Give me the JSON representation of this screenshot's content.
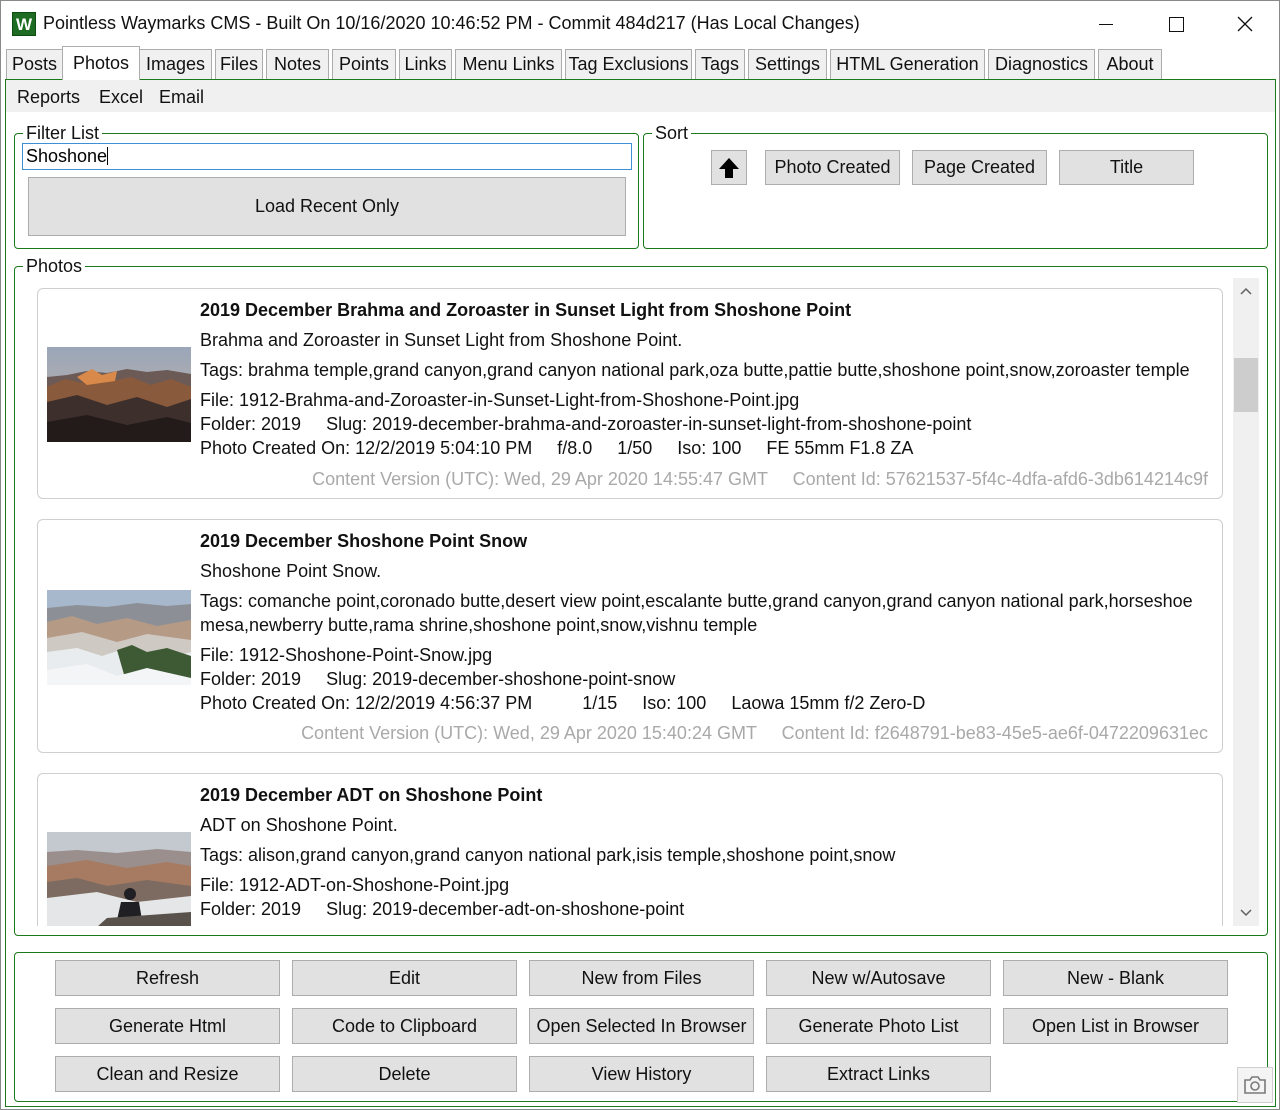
{
  "window": {
    "title": "Pointless Waymarks CMS - Built On 10/16/2020 10:46:52 PM - Commit 484d217 (Has Local Changes)",
    "icon_letter": "W"
  },
  "tabs": [
    {
      "label": "Posts"
    },
    {
      "label": "Photos",
      "active": true
    },
    {
      "label": "Images"
    },
    {
      "label": "Files"
    },
    {
      "label": "Notes"
    },
    {
      "label": "Points"
    },
    {
      "label": "Links"
    },
    {
      "label": "Menu Links"
    },
    {
      "label": "Tag Exclusions"
    },
    {
      "label": "Tags"
    },
    {
      "label": "Settings"
    },
    {
      "label": "HTML Generation"
    },
    {
      "label": "Diagnostics"
    },
    {
      "label": "About"
    }
  ],
  "menu": {
    "reports": "Reports",
    "excel": "Excel",
    "email": "Email"
  },
  "filter": {
    "group_label": "Filter List",
    "value": "Shoshone",
    "load_recent_label": "Load Recent Only"
  },
  "sort": {
    "group_label": "Sort",
    "photo_created_label": "Photo Created",
    "page_created_label": "Page Created",
    "title_label": "Title"
  },
  "photos": {
    "group_label": "Photos",
    "items": [
      {
        "title": "2019 December Brahma and Zoroaster in Sunset Light from Shoshone Point",
        "summary": "Brahma and Zoroaster in Sunset Light from Shoshone Point.",
        "tags": "Tags: brahma temple,grand canyon,grand canyon national park,oza butte,pattie butte,shoshone point,snow,zoroaster temple",
        "file": "File: 1912-Brahma-and-Zoroaster-in-Sunset-Light-from-Shoshone-Point.jpg",
        "folder_slug": "Folder: 2019     Slug: 2019-december-brahma-and-zoroaster-in-sunset-light-from-shoshone-point",
        "photo_info": "Photo Created On: 12/2/2019 5:04:10 PM     f/8.0     1/50     Iso: 100     FE 55mm F1.8 ZA",
        "meta": "Content Version (UTC): Wed, 29 Apr 2020 14:55:47 GMT     Content Id: 57621537-5f4c-4dfa-afd6-3db614214c9f"
      },
      {
        "title": "2019 December Shoshone Point Snow",
        "summary": "Shoshone Point Snow.",
        "tags": "Tags: comanche point,coronado butte,desert view point,escalante butte,grand canyon,grand canyon national park,horseshoe mesa,newberry butte,rama shrine,shoshone point,snow,vishnu temple",
        "file": "File: 1912-Shoshone-Point-Snow.jpg",
        "folder_slug": "Folder: 2019     Slug: 2019-december-shoshone-point-snow",
        "photo_info": "Photo Created On: 12/2/2019 4:56:37 PM          1/15     Iso: 100     Laowa 15mm f/2 Zero-D",
        "meta": "Content Version (UTC): Wed, 29 Apr 2020 15:40:24 GMT     Content Id: f2648791-be83-45e5-ae6f-0472209631ec"
      },
      {
        "title": "2019 December ADT on Shoshone Point",
        "summary": "ADT on Shoshone Point.",
        "tags": "Tags: alison,grand canyon,grand canyon national park,isis temple,shoshone point,snow",
        "file": "File: 1912-ADT-on-Shoshone-Point.jpg",
        "folder_slug": "Folder: 2019     Slug: 2019-december-adt-on-shoshone-point"
      }
    ]
  },
  "actions": {
    "refresh": "Refresh",
    "edit": "Edit",
    "new_from_files": "New from Files",
    "new_autosave": "New w/Autosave",
    "new_blank": "New - Blank",
    "generate_html": "Generate Html",
    "code_to_clipboard": "Code to Clipboard",
    "open_selected": "Open Selected In Browser",
    "generate_photo_list": "Generate Photo List",
    "open_list": "Open List in Browser",
    "clean_resize": "Clean and Resize",
    "delete": "Delete",
    "view_history": "View History",
    "extract_links": "Extract Links"
  },
  "colors": {
    "accent_green": "#1a7a1a",
    "button_face": "#e1e1e1",
    "focus_blue": "#3f8fd8"
  },
  "icons": [
    "app-icon",
    "minimize-icon",
    "maximize-icon",
    "close-icon",
    "arrow-up-icon",
    "chevron-up-icon",
    "chevron-down-icon",
    "camera-icon"
  ]
}
